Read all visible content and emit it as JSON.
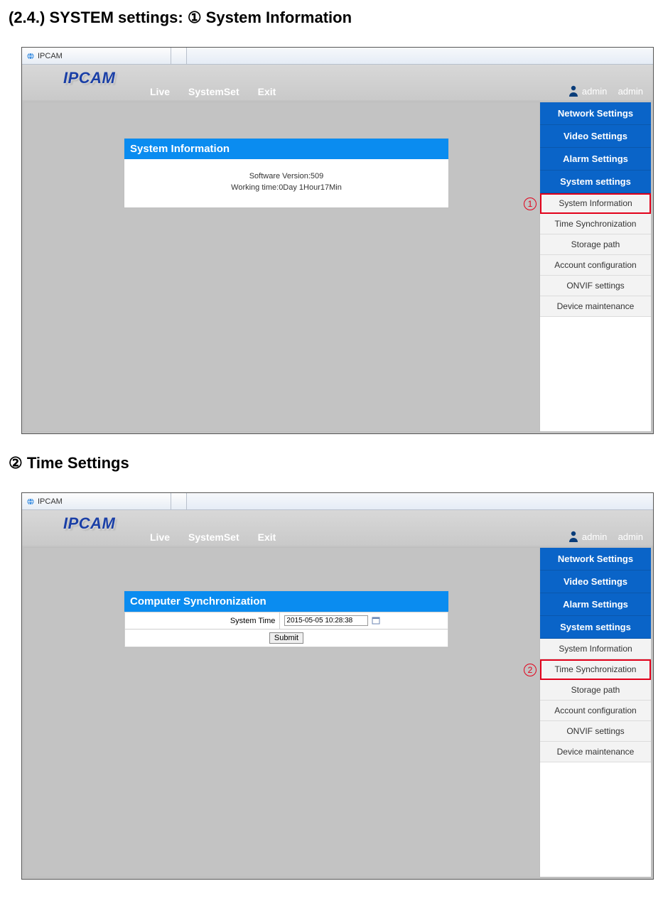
{
  "doc": {
    "heading1_prefix": "(2.4.) SYSTEM settings: ",
    "heading1_marker": "①",
    "heading1_suffix": " System Information",
    "heading2_marker": "②",
    "heading2_text": " Time Settings"
  },
  "shot1": {
    "tab_title": "IPCAM",
    "logo": "IPCAM",
    "nav": {
      "live": "Live",
      "systemset": "SystemSet",
      "exit": "Exit"
    },
    "user": {
      "name1": "admin",
      "name2": "admin"
    },
    "panel": {
      "title": "System Information",
      "sw_label": "Software Version:",
      "sw_value": "509",
      "wt_label": "Working time:",
      "wt_value": "0Day 1Hour17Min"
    },
    "sidebar": {
      "network": "Network Settings",
      "video": "Video Settings",
      "alarm": "Alarm Settings",
      "system": "System settings",
      "items": [
        "System Information",
        "Time Synchronization",
        "Storage path",
        "Account configuration",
        "ONVIF settings",
        "Device maintenance"
      ],
      "highlight_index": 0,
      "callout": "1"
    }
  },
  "shot2": {
    "tab_title": "IPCAM",
    "logo": "IPCAM",
    "nav": {
      "live": "Live",
      "systemset": "SystemSet",
      "exit": "Exit"
    },
    "user": {
      "name1": "admin",
      "name2": "admin"
    },
    "panel": {
      "title": "Computer Synchronization",
      "systime_label": "System Time",
      "systime_value": "2015-05-05 10:28:38",
      "submit": "Submit"
    },
    "sidebar": {
      "network": "Network Settings",
      "video": "Video Settings",
      "alarm": "Alarm Settings",
      "system": "System settings",
      "items": [
        "System Information",
        "Time Synchronization",
        "Storage path",
        "Account configuration",
        "ONVIF settings",
        "Device maintenance"
      ],
      "highlight_index": 1,
      "callout": "2"
    }
  }
}
